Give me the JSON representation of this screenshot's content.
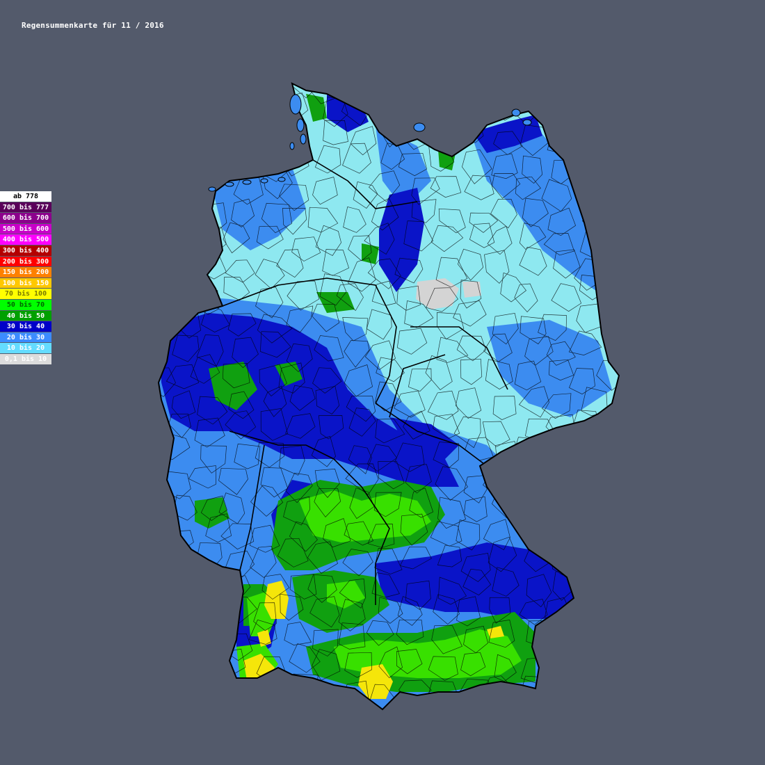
{
  "title": "Regensummenkarte für 11 / 2016",
  "legend": [
    {
      "label": "ab 778",
      "color": "#ffffff",
      "text_color": "#000000"
    },
    {
      "label": "700 bis 777",
      "color": "#5a005a",
      "text_color": "#ffffff"
    },
    {
      "label": "600 bis 700",
      "color": "#8c008c",
      "text_color": "#ffffff"
    },
    {
      "label": "500 bis 600",
      "color": "#c800c8",
      "text_color": "#ffffff"
    },
    {
      "label": "400 bis 500",
      "color": "#ff00ff",
      "text_color": "#ffffff"
    },
    {
      "label": "300 bis 400",
      "color": "#b40000",
      "text_color": "#ffffff"
    },
    {
      "label": "200 bis 300",
      "color": "#ff0000",
      "text_color": "#ffffff"
    },
    {
      "label": "150 bis 200",
      "color": "#ff8000",
      "text_color": "#ffffff"
    },
    {
      "label": "100 bis 150",
      "color": "#ffc800",
      "text_color": "#ffffff"
    },
    {
      "label": "70 bis 100",
      "color": "#ffff00",
      "text_color": "#7a7a00"
    },
    {
      "label": "50 bis 70",
      "color": "#00ff00",
      "text_color": "#006400"
    },
    {
      "label": "40 bis 50",
      "color": "#00a000",
      "text_color": "#ffffff"
    },
    {
      "label": "30 bis 40",
      "color": "#0000c8",
      "text_color": "#ffffff"
    },
    {
      "label": "20 bis 30",
      "color": "#3c8cff",
      "text_color": "#ffffff"
    },
    {
      "label": "10 bis 20",
      "color": "#64dcff",
      "text_color": "#ffffff"
    },
    {
      "label": "0,1 bis 10",
      "color": "#dcdcdc",
      "text_color": "#ffffff"
    }
  ],
  "map_colors": {
    "background": "#535a6b",
    "border": "#000000",
    "c10_20": "#8ee8f0",
    "c20_30": "#3c8cf0",
    "c30_40": "#0a14c8",
    "c40_50": "#10a010",
    "c50_70": "#38e000",
    "c70_100": "#f5e60a",
    "c0_10": "#d4d4d4"
  }
}
